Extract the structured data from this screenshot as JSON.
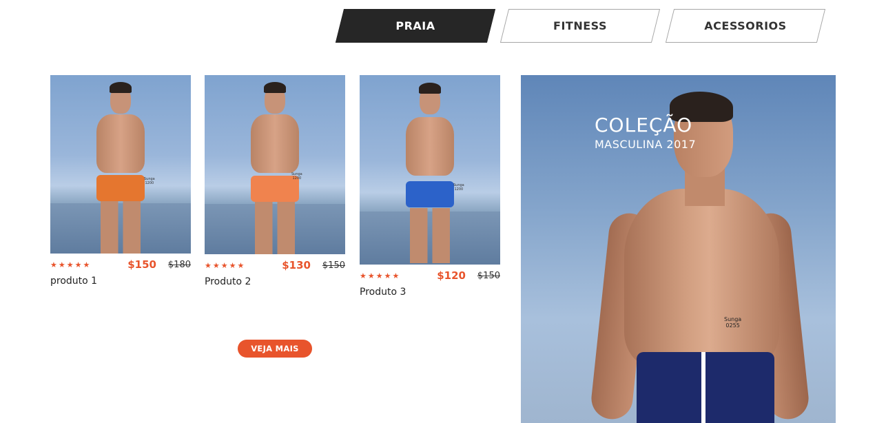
{
  "tabs": [
    {
      "label": "PRAIA",
      "active": true
    },
    {
      "label": "FITNESS",
      "active": false
    },
    {
      "label": "ACESSORIOS",
      "active": false
    }
  ],
  "products": [
    {
      "name": "produto 1",
      "price": "$150",
      "old_price": "$180",
      "rating": 5,
      "stars": "★★★★★",
      "tag": "Sunga\n1200",
      "shorts_color": "#e5762f"
    },
    {
      "name": "Produto 2",
      "price": "$130",
      "old_price": "$150",
      "rating": 5,
      "stars": "★★★★★",
      "tag": "Sunga\n1200",
      "shorts_color": "#f0834e"
    },
    {
      "name": "Produto 3",
      "price": "$120",
      "old_price": "$150",
      "rating": 5,
      "stars": "★★★★★",
      "tag": "Sunga\n1200",
      "shorts_color": "#2c62c9"
    }
  ],
  "more_button": "VEJA MAIS",
  "banner": {
    "title": "COLEÇÃO",
    "subtitle": "MASCULINA 2017",
    "tag_line1": "Sunga",
    "tag_line2": "0255"
  },
  "colors": {
    "accent": "#e8542c",
    "active_tab": "#262626"
  }
}
